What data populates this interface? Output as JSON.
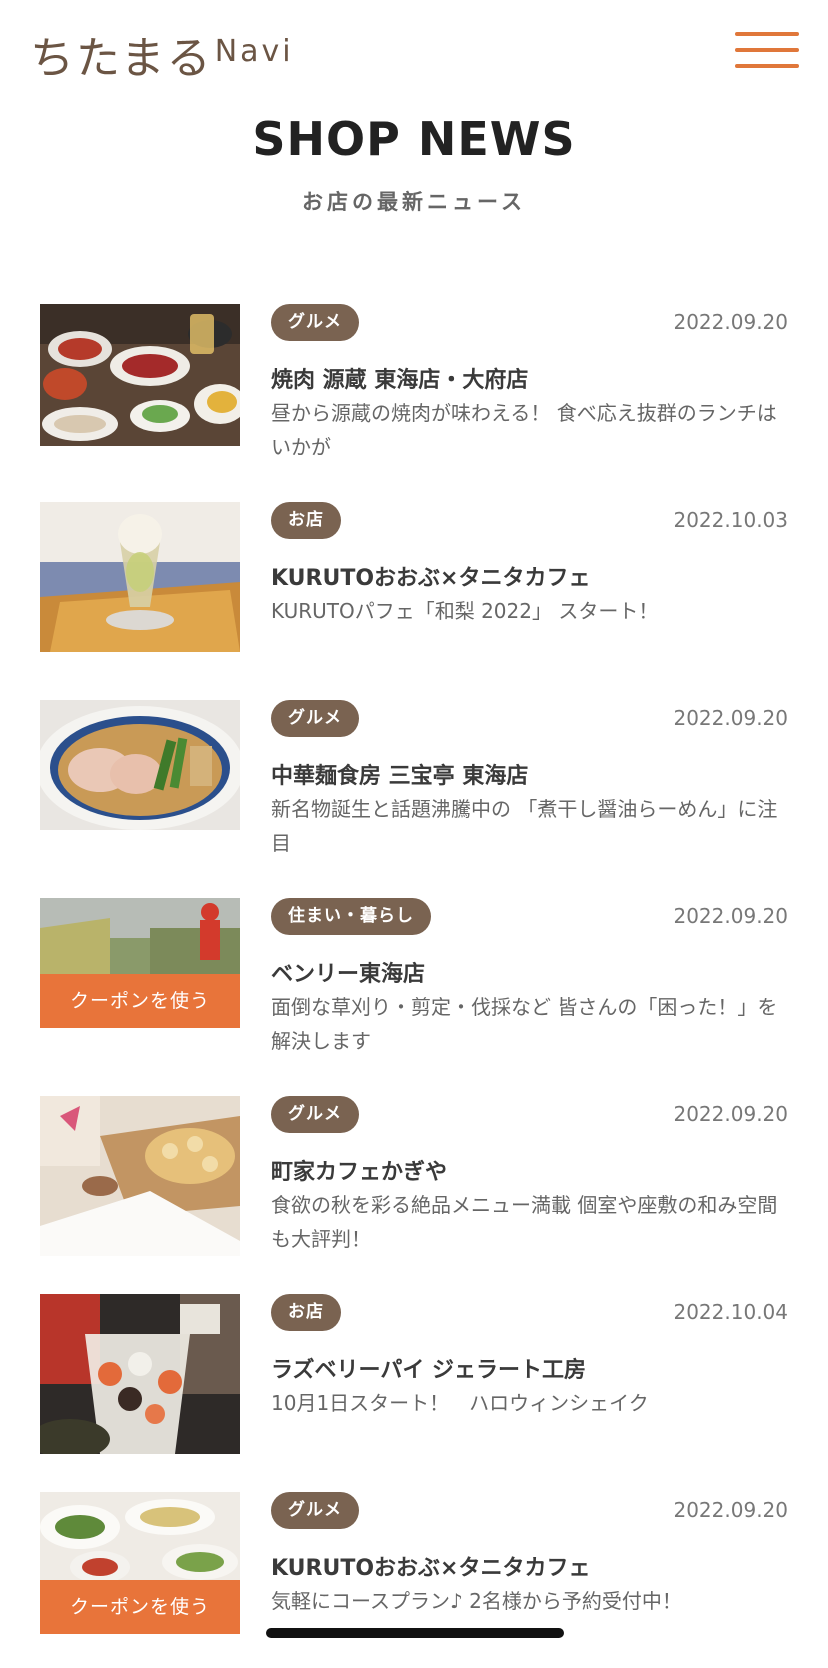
{
  "header": {
    "logo_main": "ちたまる",
    "logo_sub": "Navi"
  },
  "page": {
    "title": "SHOP NEWS",
    "subtitle": "お店の最新ニュース"
  },
  "news": [
    {
      "category": "グルメ",
      "date": "2022.09.20",
      "shop": "焼肉 源蔵 東海店・大府店",
      "description": "昼から源蔵の焼肉が味わえる！ 食べ応え抜群のランチはいかが",
      "coupon": ""
    },
    {
      "category": "お店",
      "date": "2022.10.03",
      "shop": "KURUTOおおぶ×タニタカフェ",
      "description": "KURUTOパフェ「和梨 2022」 スタート！",
      "coupon": ""
    },
    {
      "category": "グルメ",
      "date": "2022.09.20",
      "shop": "中華麺食房 三宝亭 東海店",
      "description": "新名物誕生と話題沸騰中の 「煮干し醤油らーめん」に注目",
      "coupon": ""
    },
    {
      "category": "住まい・暮らし",
      "date": "2022.09.20",
      "shop": "ベンリー東海店",
      "description": "面倒な草刈り・剪定・伐採など 皆さんの「困った！」を解決します",
      "coupon": "クーポンを使う"
    },
    {
      "category": "グルメ",
      "date": "2022.09.20",
      "shop": "町家カフェかぎや",
      "description": "食欲の秋を彩る絶品メニュー満載 個室や座敷の和み空間も大評判！",
      "coupon": ""
    },
    {
      "category": "お店",
      "date": "2022.10.04",
      "shop": "ラズベリーパイ ジェラート工房",
      "description": "10月1日スタート！　ハロウィンシェイク",
      "coupon": ""
    },
    {
      "category": "グルメ",
      "date": "2022.09.20",
      "shop": "KURUTOおおぶ×タニタカフェ",
      "description": "気軽にコースプラン♪ 2名様から予約受付中！",
      "coupon": "クーポンを使う"
    }
  ],
  "colors": {
    "accent": "#e8743a",
    "badge": "#7a6351",
    "logo": "#6b5544"
  },
  "icons": {
    "menu": "hamburger-menu-icon"
  }
}
